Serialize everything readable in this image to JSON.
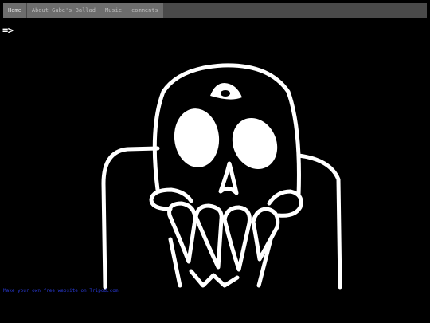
{
  "nav": {
    "items": [
      {
        "label": "Home"
      },
      {
        "label": "About Gabe's Ballad"
      },
      {
        "label": "Music"
      },
      {
        "label": "comments"
      }
    ]
  },
  "main": {
    "arrow_text": "=>"
  },
  "footer": {
    "link_text": "Make your own free website on Tripod.com"
  },
  "colors": {
    "background": "#000000",
    "navbar": "#4a4a4a",
    "nav_active": "#6d6d6d",
    "drawing": "#ffffff",
    "link": "#2a3ad6"
  },
  "icons": {
    "illustration": "skull-drawing"
  }
}
